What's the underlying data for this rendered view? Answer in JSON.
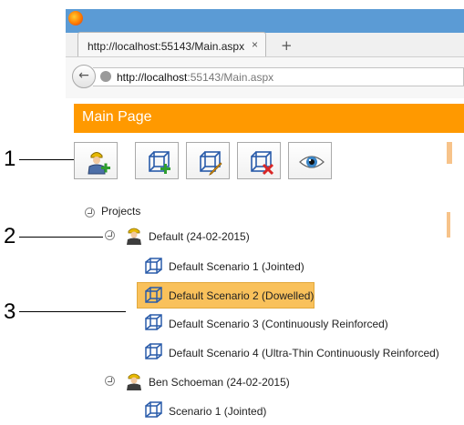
{
  "browser": {
    "tab_title": "http://localhost:55143/Main.aspx",
    "tab_close": "×",
    "new_tab": "+",
    "back": "←",
    "url_host": "http://localhost",
    "url_rest": ":55143/Main.aspx"
  },
  "page": {
    "title": "Main Page"
  },
  "toolbar": {
    "buttons": [
      {
        "name": "add-project",
        "icon": "user-add-icon"
      },
      {
        "name": "add-scenario",
        "icon": "cube-add-icon"
      },
      {
        "name": "edit-scenario",
        "icon": "cube-edit-icon"
      },
      {
        "name": "delete-scenario",
        "icon": "cube-delete-icon"
      },
      {
        "name": "view",
        "icon": "eye-icon"
      }
    ]
  },
  "callouts": [
    "1",
    "2",
    "3"
  ],
  "tree": {
    "root": "Projects",
    "projects": [
      {
        "label": "Default (24-02-2015)",
        "scenarios": [
          "Default Scenario 1 (Jointed)",
          "Default Scenario 2 (Dowelled)",
          "Default Scenario 3 (Continuously Reinforced)",
          "Default Scenario 4 (Ultra-Thin Continuously Reinforced)"
        ]
      },
      {
        "label": "Ben Schoeman (24-02-2015)",
        "scenarios": [
          "Scenario 1 (Jointed)"
        ]
      }
    ],
    "selected": "Default Scenario 2 (Dowelled)"
  },
  "colors": {
    "header": "#ff9900",
    "selection": "#f9c15b",
    "titlebar": "#5b9bd5"
  }
}
